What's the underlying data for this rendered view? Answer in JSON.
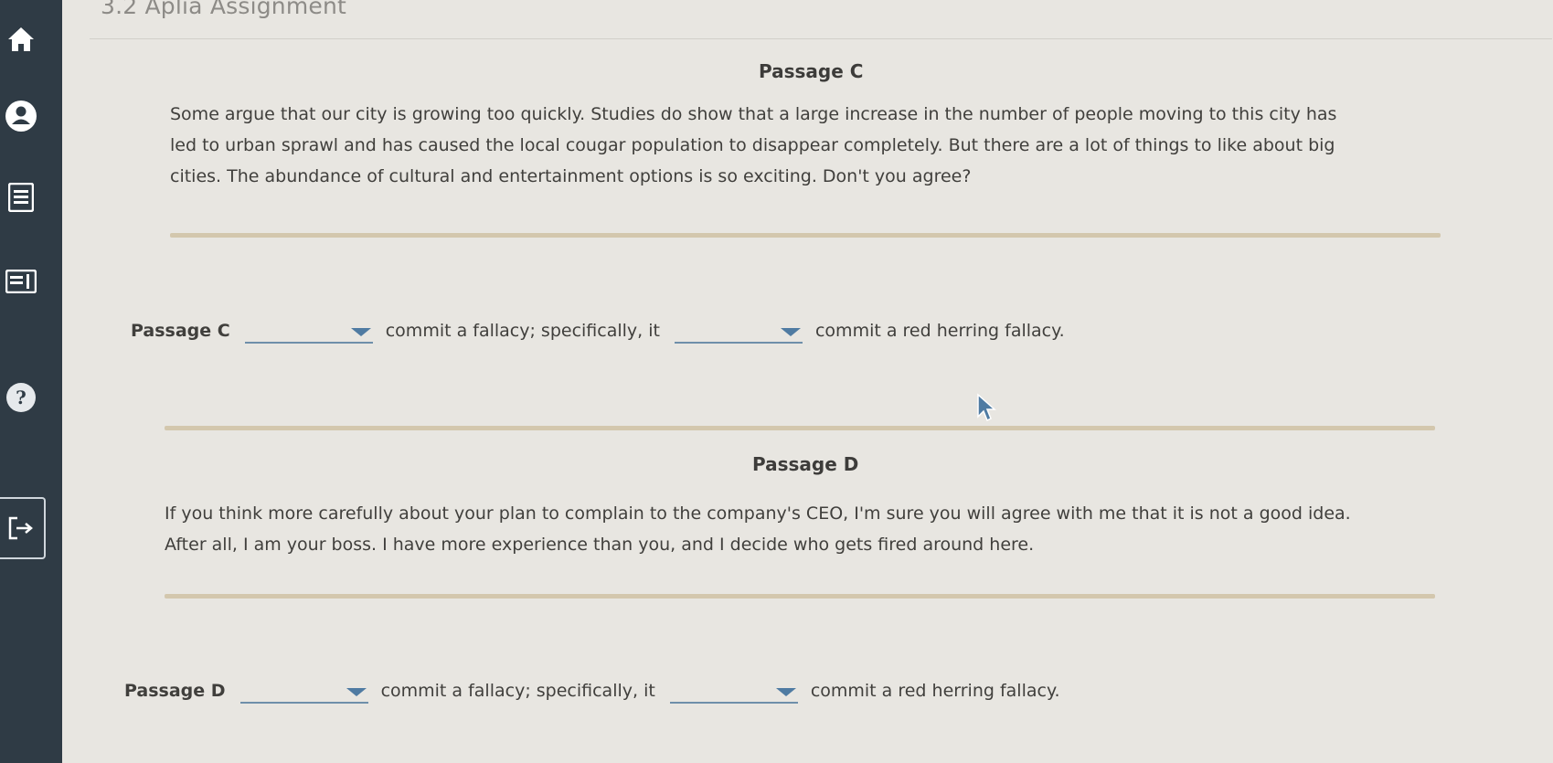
{
  "assignment": {
    "title": "3.2 Aplia Assignment"
  },
  "sidebar": {
    "icons": [
      "home-icon",
      "user-icon",
      "list-icon",
      "grade-book-icon",
      "help-icon",
      "exit-icon"
    ]
  },
  "passage_c": {
    "heading": "Passage C",
    "lines": [
      "Some argue that our city is growing too quickly. Studies do show that a large increase in the number of people moving to this city has",
      "led to urban sprawl and has caused the local cougar population to disappear completely. But there are a lot of things to like about big",
      "cities. The abundance of cultural and entertainment options is so exciting. Don't you agree?"
    ],
    "answer": {
      "label": "Passage C",
      "text_1": "commit a fallacy; specifically, it",
      "text_2": "commit a red herring fallacy."
    }
  },
  "passage_d": {
    "heading": "Passage D",
    "lines": [
      "If you think more carefully about your plan to complain to the company's CEO, I'm sure you will agree with me that it is not a good idea.",
      "After all, I am your boss. I have more experience than you, and I decide who gets fired around here."
    ],
    "answer": {
      "label": "Passage D",
      "text_1": "commit a fallacy; specifically, it",
      "text_2": "commit a red herring fallacy."
    }
  },
  "colors": {
    "sidebar": "#2f3b45",
    "divider": "#d3c7ad",
    "dropdown_accent": "#4f7ba2"
  }
}
